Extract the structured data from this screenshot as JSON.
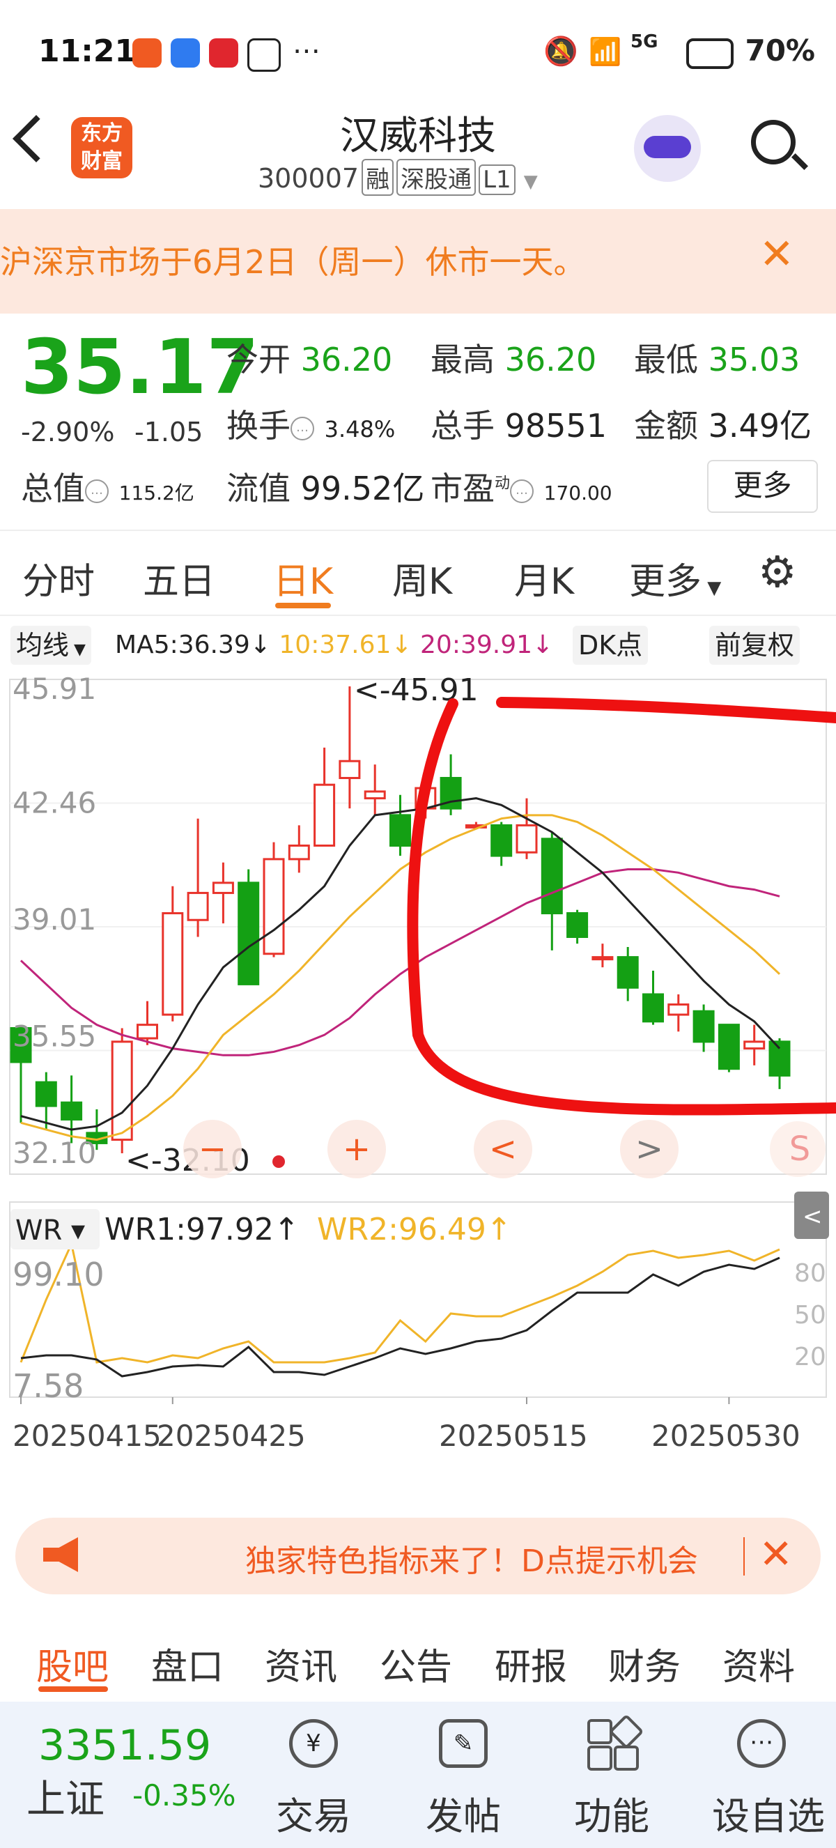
{
  "status_bar": {
    "time": "11:21",
    "battery": "70%",
    "network": "5G"
  },
  "header": {
    "title": "汉威科技",
    "code": "300007",
    "tags": [
      "融",
      "深股通",
      "L1"
    ],
    "app_logo": "东方\n财富"
  },
  "banner": {
    "text": "沪深京市场于6月2日（周一）休市一天。",
    "close": "✕"
  },
  "quote": {
    "price": "35.17",
    "change_pct": "-2.90%",
    "change": "-1.05",
    "open_label": "今开",
    "open": "36.20",
    "high_label": "最高",
    "high": "36.20",
    "low_label": "最低",
    "low": "35.03",
    "turnover_label": "换手",
    "turnover": "3.48%",
    "volume_label": "总手",
    "volume": "98551",
    "amount_label": "金额",
    "amount": "3.49亿",
    "mktcap_label": "总值",
    "mktcap": "115.2亿",
    "float_label": "流值",
    "float": "99.52亿",
    "pe_label": "市盈",
    "pe_sup": "动",
    "pe": "170.00",
    "more_button": "更多"
  },
  "tabs": [
    "分时",
    "五日",
    "日K",
    "周K",
    "月K",
    "更多"
  ],
  "active_tab": "日K",
  "chart_toolbar": {
    "ma_select": "均线",
    "ma5": "MA5:36.39↓",
    "ma10": "10:37.61↓",
    "ma20": "20:39.91↓",
    "dk_button": "DK点",
    "adjust_button": "前复权"
  },
  "chart_data": [
    {
      "type": "candlestick",
      "y_ticks": [
        "45.91",
        "42.46",
        "39.01",
        "35.55",
        "32.10"
      ],
      "max_label": "<-45.91",
      "min_label": "<-32.10",
      "ylim": [
        32.1,
        45.91
      ],
      "x_ticks": [
        "20250415",
        "20250425",
        "20250515",
        "20250530"
      ],
      "candles": [
        {
          "o": 35.8,
          "c": 34.8,
          "h": 35.8,
          "l": 33.0
        },
        {
          "o": 34.2,
          "c": 33.5,
          "h": 34.5,
          "l": 32.8
        },
        {
          "o": 33.6,
          "c": 33.1,
          "h": 34.4,
          "l": 32.4
        },
        {
          "o": 32.7,
          "c": 32.4,
          "h": 33.4,
          "l": 32.2
        },
        {
          "o": 32.5,
          "c": 35.4,
          "h": 35.8,
          "l": 32.1
        },
        {
          "o": 35.5,
          "c": 35.9,
          "h": 36.6,
          "l": 35.3
        },
        {
          "o": 36.2,
          "c": 39.2,
          "h": 40.0,
          "l": 36.0
        },
        {
          "o": 39.0,
          "c": 39.8,
          "h": 42.0,
          "l": 38.5
        },
        {
          "o": 39.8,
          "c": 40.1,
          "h": 40.7,
          "l": 38.9
        },
        {
          "o": 40.1,
          "c": 37.1,
          "h": 40.5,
          "l": 37.1
        },
        {
          "o": 38.0,
          "c": 40.8,
          "h": 41.3,
          "l": 37.9
        },
        {
          "o": 40.8,
          "c": 41.2,
          "h": 41.8,
          "l": 40.4
        },
        {
          "o": 41.2,
          "c": 43.0,
          "h": 44.1,
          "l": 41.2
        },
        {
          "o": 43.2,
          "c": 43.7,
          "h": 45.91,
          "l": 42.3
        },
        {
          "o": 42.6,
          "c": 42.8,
          "h": 43.6,
          "l": 42.1
        },
        {
          "o": 42.1,
          "c": 41.2,
          "h": 42.7,
          "l": 40.9
        },
        {
          "o": 42.3,
          "c": 42.9,
          "h": 43.3,
          "l": 42.0
        },
        {
          "o": 43.2,
          "c": 42.3,
          "h": 43.9,
          "l": 42.1
        },
        {
          "o": 41.8,
          "c": 41.8,
          "h": 41.9,
          "l": 41.7
        },
        {
          "o": 41.8,
          "c": 40.9,
          "h": 41.9,
          "l": 40.6
        },
        {
          "o": 41.0,
          "c": 41.8,
          "h": 42.6,
          "l": 40.8
        },
        {
          "o": 41.4,
          "c": 39.2,
          "h": 41.6,
          "l": 38.1
        },
        {
          "o": 39.2,
          "c": 38.5,
          "h": 39.3,
          "l": 38.3
        },
        {
          "o": 37.9,
          "c": 37.9,
          "h": 38.3,
          "l": 37.6
        },
        {
          "o": 37.9,
          "c": 37.0,
          "h": 38.2,
          "l": 36.6
        },
        {
          "o": 36.8,
          "c": 36.0,
          "h": 37.5,
          "l": 35.9
        },
        {
          "o": 36.2,
          "c": 36.5,
          "h": 36.8,
          "l": 35.7
        },
        {
          "o": 36.3,
          "c": 35.4,
          "h": 36.5,
          "l": 35.1
        },
        {
          "o": 35.9,
          "c": 34.6,
          "h": 35.9,
          "l": 34.5
        },
        {
          "o": 35.2,
          "c": 35.4,
          "h": 35.9,
          "l": 34.7
        },
        {
          "o": 35.4,
          "c": 34.4,
          "h": 35.5,
          "l": 34.0
        }
      ],
      "ma5": [
        33.2,
        33.0,
        32.8,
        32.9,
        33.3,
        34.1,
        35.2,
        36.5,
        37.6,
        38.2,
        38.7,
        39.3,
        40.0,
        41.2,
        42.1,
        42.2,
        42.3,
        42.5,
        42.6,
        42.4,
        42.0,
        41.6,
        41.0,
        40.4,
        39.6,
        38.8,
        38.0,
        37.2,
        36.5,
        36.0,
        35.2
      ],
      "ma10": [
        33.0,
        32.8,
        32.6,
        32.5,
        32.7,
        33.2,
        33.8,
        34.6,
        35.6,
        36.2,
        36.8,
        37.5,
        38.3,
        39.1,
        39.8,
        40.5,
        41.0,
        41.4,
        41.7,
        42.0,
        42.1,
        42.1,
        41.9,
        41.5,
        41.0,
        40.5,
        39.9,
        39.3,
        38.7,
        38.1,
        37.4
      ],
      "ma20": [
        37.8,
        37.1,
        36.4,
        35.9,
        35.6,
        35.4,
        35.2,
        35.1,
        35.0,
        35.0,
        35.1,
        35.3,
        35.6,
        36.1,
        36.8,
        37.4,
        37.9,
        38.3,
        38.7,
        39.1,
        39.5,
        39.8,
        40.1,
        40.4,
        40.5,
        40.5,
        40.4,
        40.2,
        40.0,
        39.9,
        39.7
      ],
      "buttons": [
        "−",
        "+",
        "<",
        ">",
        "S"
      ]
    },
    {
      "type": "line",
      "title": "WR",
      "series": [
        {
          "name": "WR1:97.92↑",
          "values": [
            18,
            20,
            20,
            17,
            5,
            8,
            12,
            13,
            12,
            26,
            8,
            8,
            6,
            12,
            18,
            25,
            21,
            25,
            30,
            32,
            38,
            52,
            65,
            65,
            65,
            78,
            70,
            80,
            85,
            82,
            90
          ]
        },
        {
          "name": "WR2:96.49↑",
          "values": [
            15,
            60,
            100,
            15,
            18,
            15,
            20,
            18,
            25,
            30,
            15,
            15,
            15,
            18,
            22,
            45,
            30,
            50,
            48,
            48,
            55,
            62,
            70,
            80,
            92,
            95,
            90,
            92,
            95,
            88,
            96
          ]
        }
      ],
      "y_ticks": [
        "99.10",
        "7.58"
      ],
      "right_ticks": [
        "80",
        "50",
        "20"
      ],
      "ylim": [
        0,
        100
      ]
    }
  ],
  "promo": {
    "text": "独家特色指标来了！D点提示机会",
    "close": "✕"
  },
  "bottom_tabs": [
    "股吧",
    "盘口",
    "资讯",
    "公告",
    "研报",
    "财务",
    "资料"
  ],
  "bottom_active": "股吧",
  "navbar": {
    "index_value": "3351.59",
    "index_name": "上证",
    "index_change": "-0.35%",
    "items": [
      "交易",
      "发帖",
      "功能",
      "设自选"
    ]
  }
}
